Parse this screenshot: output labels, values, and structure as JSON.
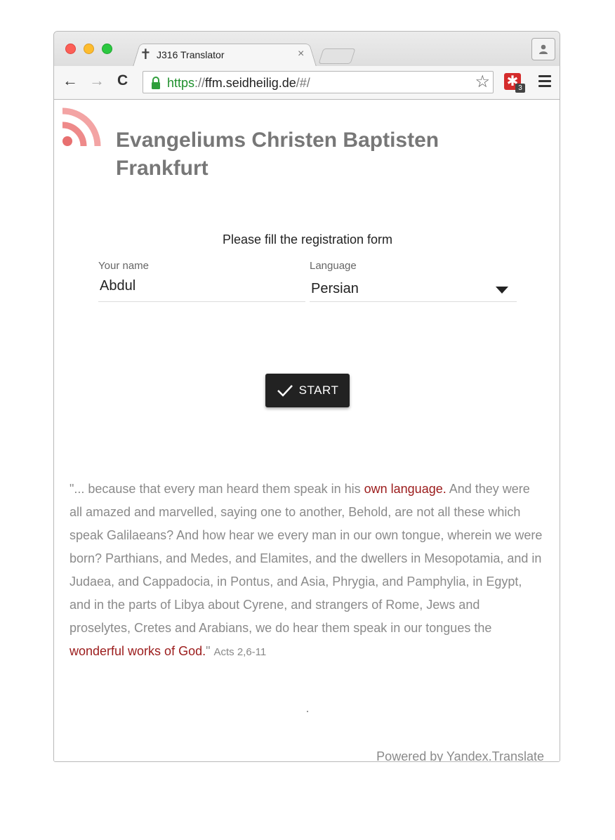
{
  "browser": {
    "tab_title": "J316 Translator",
    "tab_close": "×",
    "tab_favicon": "✝",
    "url_scheme": "https",
    "url_sep": "://",
    "url_host": "ffm.seidheilig.de",
    "url_path": "/#/",
    "back_icon": "←",
    "forward_icon": "→",
    "reload_icon": "C",
    "star_icon": "☆",
    "extension_icon": "✱",
    "extension_badge": "3"
  },
  "page": {
    "site_title": "Evangeliums Christen Baptisten Frankfurt",
    "form_title": "Please fill the registration form",
    "name_label": "Your name",
    "name_value": "Abdul",
    "language_label": "Language",
    "language_value": "Persian",
    "start_label": "START",
    "quote": {
      "part1": "\"... because that every man heard them speak in his ",
      "highlight1": "own language.",
      "part2": " And they were all amazed and marvelled, saying one to another, Behold, are not all these which speak Galilaeans? And how hear we every man in our own tongue, wherein we were born? Parthians, and Medes, and Elamites, and the dwellers in Mesopotamia, and in Judaea, and Cappadocia, in Pontus, and Asia, Phrygia, and Pamphylia, in Egypt, and in the parts of Libya about Cyrene, and strangers of Rome, Jews and proselytes, Cretes and Arabians, we do hear them speak in our tongues the ",
      "highlight2": "wonderful works of God.",
      "part3": "\" ",
      "reference": "Acts 2,6-11"
    },
    "powered_prefix": "Powered by ",
    "powered_link": "Yandex",
    "powered_suffix": ".Translate"
  },
  "colors": {
    "highlight": "#9b1b1b",
    "title_gray": "#777777",
    "button_dark": "#222222",
    "url_green": "#1e8f2c"
  }
}
